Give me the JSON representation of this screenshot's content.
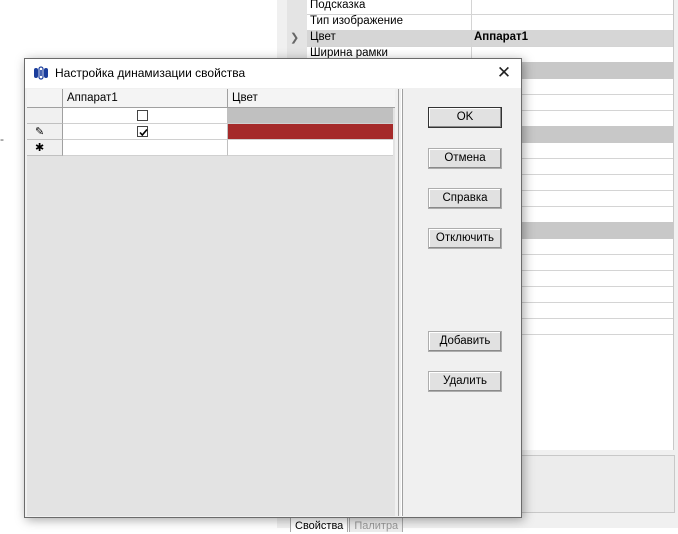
{
  "properties": {
    "rows": [
      {
        "name": "Подсказка",
        "value": "",
        "state": "normal"
      },
      {
        "name": "Тип изображение",
        "value": "",
        "state": "normal"
      },
      {
        "name": "Цвет",
        "value": "Аппарат1",
        "state": "selected"
      },
      {
        "name": "Ширина рамки",
        "value": "",
        "state": "normal"
      }
    ],
    "tabs": [
      "Свойства",
      "Палитра"
    ]
  },
  "dialog": {
    "title": "Настройка динамизации свойства",
    "close_label": "✕",
    "grid": {
      "columns": [
        "Аппарат1",
        "Цвет"
      ],
      "rows": [
        {
          "marker": "",
          "checked": false,
          "color": "#c0c0c0"
        },
        {
          "marker": "✎",
          "checked": true,
          "color": "#a52a2a"
        },
        {
          "marker": "✱",
          "checked": null,
          "color": ""
        }
      ]
    },
    "buttons": {
      "ok": "OK",
      "cancel": "Отмена",
      "help": "Справка",
      "disable": "Отключить",
      "add": "Добавить",
      "delete": "Удалить"
    }
  },
  "background": {
    "dash": "-"
  }
}
